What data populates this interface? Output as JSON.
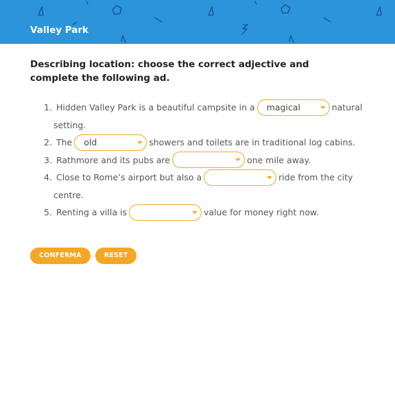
{
  "header": {
    "title": "Valley Park"
  },
  "instructions": "Describing location: choose the correct adjective and complete the following ad.",
  "items": [
    {
      "num": "1.",
      "before": "Hidden Valley Park is a beautiful campsite in a",
      "select_value": "magical",
      "after": "natural",
      "after2": "setting."
    },
    {
      "num": "2.",
      "before": "The",
      "select_value": "old",
      "after": "showers and toilets are in traditional log cabins."
    },
    {
      "num": "3.",
      "before": "Rathmore and its pubs are",
      "select_value": "",
      "after": "one mile away."
    },
    {
      "num": "4.",
      "before": "Close to Rome’s airport but also a",
      "select_value": "",
      "after": "ride from the city",
      "after2": "centre."
    },
    {
      "num": "5.",
      "before": "Renting a villa is",
      "select_value": "",
      "after": "value for money right now."
    }
  ],
  "buttons": {
    "confirm": "CONFERMA",
    "reset": "RESET"
  },
  "colors": {
    "header_bg": "#2c94da",
    "accent": "#f5a623"
  }
}
